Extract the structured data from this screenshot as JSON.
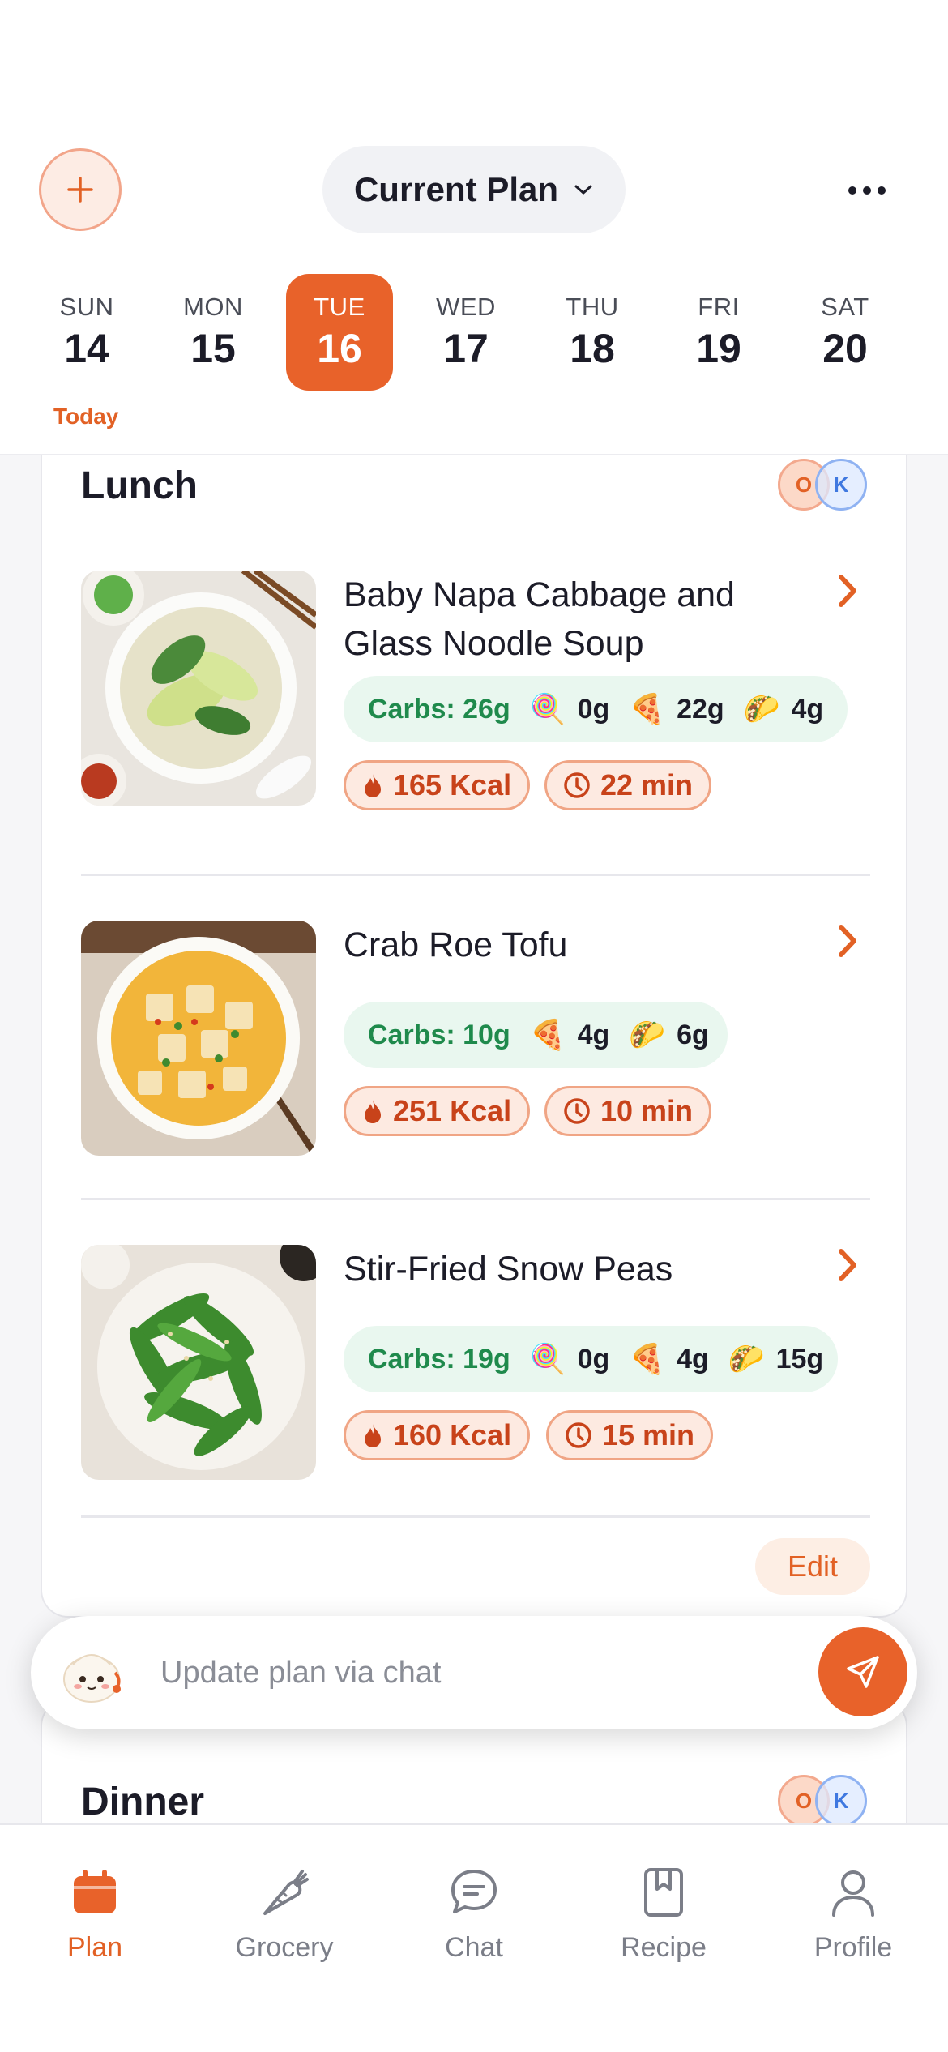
{
  "header": {
    "plan_label": "Current Plan",
    "add_icon": "plus-icon",
    "more_icon": "ellipsis-icon",
    "today_label": "Today"
  },
  "days": [
    {
      "name": "SUN",
      "date": "14"
    },
    {
      "name": "MON",
      "date": "15"
    },
    {
      "name": "TUE",
      "date": "16"
    },
    {
      "name": "WED",
      "date": "17"
    },
    {
      "name": "THU",
      "date": "18"
    },
    {
      "name": "FRI",
      "date": "19"
    },
    {
      "name": "SAT",
      "date": "20"
    }
  ],
  "selected_day": "TUE",
  "lunch": {
    "title": "Lunch",
    "avatars": [
      "O",
      "K"
    ],
    "recipes": [
      {
        "title": "Baby Napa Cabbage and Glass Noodle Soup",
        "carbs": "Carbs: 26g",
        "sugar": "0g",
        "protein": "22g",
        "fat": "4g",
        "kcal": "165 Kcal",
        "time": "22 min"
      },
      {
        "title": "Crab Roe Tofu",
        "carbs": "Carbs: 10g",
        "protein": "4g",
        "fat": "6g",
        "kcal": "251 Kcal",
        "time": "10 min"
      },
      {
        "title": "Stir-Fried Snow Peas",
        "carbs": "Carbs: 19g",
        "sugar": "0g",
        "protein": "4g",
        "fat": "15g",
        "kcal": "160 Kcal",
        "time": "15 min"
      }
    ],
    "edit_label": "Edit"
  },
  "dinner": {
    "title": "Dinner",
    "avatars": [
      "O",
      "K"
    ]
  },
  "chat": {
    "placeholder": "Update plan via chat"
  },
  "tabs": [
    {
      "label": "Plan",
      "icon": "calendar-icon"
    },
    {
      "label": "Grocery",
      "icon": "carrot-icon"
    },
    {
      "label": "Chat",
      "icon": "chat-bubble-icon"
    },
    {
      "label": "Recipe",
      "icon": "bookmark-book-icon"
    },
    {
      "label": "Profile",
      "icon": "person-icon"
    }
  ],
  "emojis": {
    "sugar": "🍭",
    "protein": "🍕",
    "fat": "🌮"
  },
  "colors": {
    "accent": "#e8622a",
    "carbs_green": "#1f8a4c",
    "pill_text": "#c8431a"
  }
}
